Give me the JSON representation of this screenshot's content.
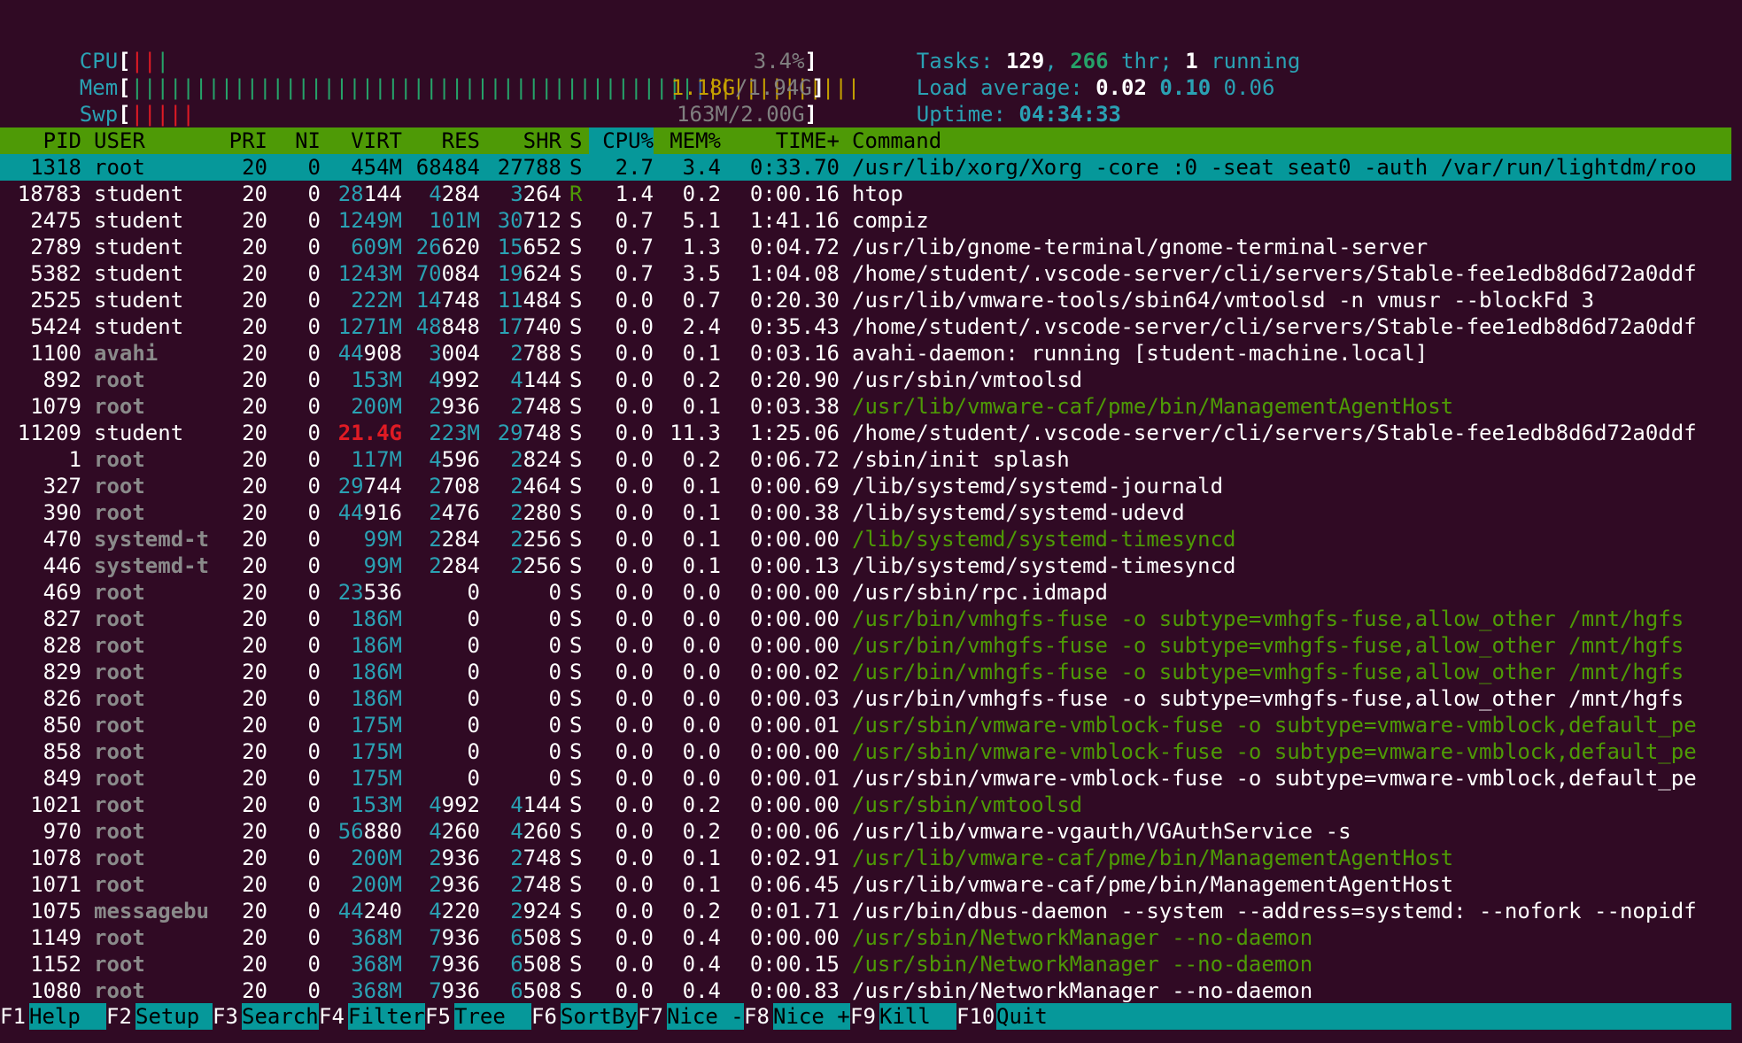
{
  "meters": {
    "cpu": {
      "label": "CPU",
      "value": "3.4%",
      "bars": [
        {
          "t": "||",
          "c": "#e01b24"
        },
        {
          "t": "|",
          "c": "#26a269"
        }
      ]
    },
    "mem": {
      "label": "Mem",
      "used": "1.18G",
      "total": "1.94G",
      "bars": [
        {
          "t": "||||||||||||||||||||||||||||||||||||||||||||",
          "c": "#26a269"
        },
        {
          "t": "|",
          "c": "#3465a4"
        },
        {
          "t": "||||||||||||",
          "c": "#c4a000"
        }
      ]
    },
    "swp": {
      "label": "Swp",
      "value": "163M/2.00G",
      "bars": [
        {
          "t": "|||||",
          "c": "#e01b24"
        }
      ]
    }
  },
  "info": {
    "tasks_label": "Tasks:",
    "tasks": "129",
    "thr": "266",
    "thr_label": "thr;",
    "running": "1",
    "running_label": "running",
    "load_label": "Load average:",
    "load1": "0.02",
    "load5": "0.10",
    "load15": "0.06",
    "uptime_label": "Uptime:",
    "uptime": "04:34:33"
  },
  "columns": [
    "PID",
    "USER",
    "PRI",
    "NI",
    "VIRT",
    "RES",
    "SHR",
    "S",
    "CPU%",
    "MEM%",
    "TIME+",
    "Command"
  ],
  "processes": [
    {
      "pid": "1318",
      "user": "root",
      "pri": "20",
      "ni": "0",
      "virt": "454M",
      "res": "68484",
      "shr": "27788",
      "s": "S",
      "cpu": "2.7",
      "mem": "3.4",
      "time": "0:33.70",
      "cmd": "/usr/lib/xorg/Xorg -core :0 -seat seat0 -auth /var/run/lightdm/roo",
      "selected": true
    },
    {
      "pid": "18783",
      "user": "student",
      "pri": "20",
      "ni": "0",
      "virt": "28144",
      "res": "4284",
      "shr": "3264",
      "s": "R",
      "cpu": "1.4",
      "mem": "0.2",
      "time": "0:00.16",
      "cmd": "htop"
    },
    {
      "pid": "2475",
      "user": "student",
      "pri": "20",
      "ni": "0",
      "virt": "1249M",
      "res": "101M",
      "shr": "30712",
      "s": "S",
      "cpu": "0.7",
      "mem": "5.1",
      "time": "1:41.16",
      "cmd": "compiz"
    },
    {
      "pid": "2789",
      "user": "student",
      "pri": "20",
      "ni": "0",
      "virt": "609M",
      "res": "26620",
      "shr": "15652",
      "s": "S",
      "cpu": "0.7",
      "mem": "1.3",
      "time": "0:04.72",
      "cmd": "/usr/lib/gnome-terminal/gnome-terminal-server"
    },
    {
      "pid": "5382",
      "user": "student",
      "pri": "20",
      "ni": "0",
      "virt": "1243M",
      "res": "70084",
      "shr": "19624",
      "s": "S",
      "cpu": "0.7",
      "mem": "3.5",
      "time": "1:04.08",
      "cmd": "/home/student/.vscode-server/cli/servers/Stable-fee1edb8d6d72a0ddf"
    },
    {
      "pid": "2525",
      "user": "student",
      "pri": "20",
      "ni": "0",
      "virt": "222M",
      "res": "14748",
      "shr": "11484",
      "s": "S",
      "cpu": "0.0",
      "mem": "0.7",
      "time": "0:20.30",
      "cmd": "/usr/lib/vmware-tools/sbin64/vmtoolsd -n vmusr --blockFd 3"
    },
    {
      "pid": "5424",
      "user": "student",
      "pri": "20",
      "ni": "0",
      "virt": "1271M",
      "res": "48848",
      "shr": "17740",
      "s": "S",
      "cpu": "0.0",
      "mem": "2.4",
      "time": "0:35.43",
      "cmd": "/home/student/.vscode-server/cli/servers/Stable-fee1edb8d6d72a0ddf"
    },
    {
      "pid": "1100",
      "user": "avahi",
      "pri": "20",
      "ni": "0",
      "virt": "44908",
      "res": "3004",
      "shr": "2788",
      "s": "S",
      "cpu": "0.0",
      "mem": "0.1",
      "time": "0:03.16",
      "cmd": "avahi-daemon: running [student-machine.local]"
    },
    {
      "pid": "892",
      "user": "root",
      "pri": "20",
      "ni": "0",
      "virt": "153M",
      "res": "4992",
      "shr": "4144",
      "s": "S",
      "cpu": "0.0",
      "mem": "0.2",
      "time": "0:20.90",
      "cmd": "/usr/sbin/vmtoolsd"
    },
    {
      "pid": "1079",
      "user": "root",
      "pri": "20",
      "ni": "0",
      "virt": "200M",
      "res": "2936",
      "shr": "2748",
      "s": "S",
      "cpu": "0.0",
      "mem": "0.1",
      "time": "0:03.38",
      "cmd": "/usr/lib/vmware-caf/pme/bin/ManagementAgentHost",
      "thread": true
    },
    {
      "pid": "11209",
      "user": "student",
      "pri": "20",
      "ni": "0",
      "virt": "21.4G",
      "res": "223M",
      "shr": "29748",
      "s": "S",
      "cpu": "0.0",
      "mem": "11.3",
      "time": "1:25.06",
      "cmd": "/home/student/.vscode-server/cli/servers/Stable-fee1edb8d6d72a0ddf",
      "virtRed": true
    },
    {
      "pid": "1",
      "user": "root",
      "pri": "20",
      "ni": "0",
      "virt": "117M",
      "res": "4596",
      "shr": "2824",
      "s": "S",
      "cpu": "0.0",
      "mem": "0.2",
      "time": "0:06.72",
      "cmd": "/sbin/init splash"
    },
    {
      "pid": "327",
      "user": "root",
      "pri": "20",
      "ni": "0",
      "virt": "29744",
      "res": "2708",
      "shr": "2464",
      "s": "S",
      "cpu": "0.0",
      "mem": "0.1",
      "time": "0:00.69",
      "cmd": "/lib/systemd/systemd-journald"
    },
    {
      "pid": "390",
      "user": "root",
      "pri": "20",
      "ni": "0",
      "virt": "44916",
      "res": "2476",
      "shr": "2280",
      "s": "S",
      "cpu": "0.0",
      "mem": "0.1",
      "time": "0:00.38",
      "cmd": "/lib/systemd/systemd-udevd"
    },
    {
      "pid": "470",
      "user": "systemd-t",
      "pri": "20",
      "ni": "0",
      "virt": "99M",
      "res": "2284",
      "shr": "2256",
      "s": "S",
      "cpu": "0.0",
      "mem": "0.1",
      "time": "0:00.00",
      "cmd": "/lib/systemd/systemd-timesyncd",
      "thread": true
    },
    {
      "pid": "446",
      "user": "systemd-t",
      "pri": "20",
      "ni": "0",
      "virt": "99M",
      "res": "2284",
      "shr": "2256",
      "s": "S",
      "cpu": "0.0",
      "mem": "0.1",
      "time": "0:00.13",
      "cmd": "/lib/systemd/systemd-timesyncd"
    },
    {
      "pid": "469",
      "user": "root",
      "pri": "20",
      "ni": "0",
      "virt": "23536",
      "res": "0",
      "shr": "0",
      "s": "S",
      "cpu": "0.0",
      "mem": "0.0",
      "time": "0:00.00",
      "cmd": "/usr/sbin/rpc.idmapd"
    },
    {
      "pid": "827",
      "user": "root",
      "pri": "20",
      "ni": "0",
      "virt": "186M",
      "res": "0",
      "shr": "0",
      "s": "S",
      "cpu": "0.0",
      "mem": "0.0",
      "time": "0:00.00",
      "cmd": "/usr/bin/vmhgfs-fuse -o subtype=vmhgfs-fuse,allow_other /mnt/hgfs",
      "thread": true
    },
    {
      "pid": "828",
      "user": "root",
      "pri": "20",
      "ni": "0",
      "virt": "186M",
      "res": "0",
      "shr": "0",
      "s": "S",
      "cpu": "0.0",
      "mem": "0.0",
      "time": "0:00.00",
      "cmd": "/usr/bin/vmhgfs-fuse -o subtype=vmhgfs-fuse,allow_other /mnt/hgfs",
      "thread": true
    },
    {
      "pid": "829",
      "user": "root",
      "pri": "20",
      "ni": "0",
      "virt": "186M",
      "res": "0",
      "shr": "0",
      "s": "S",
      "cpu": "0.0",
      "mem": "0.0",
      "time": "0:00.02",
      "cmd": "/usr/bin/vmhgfs-fuse -o subtype=vmhgfs-fuse,allow_other /mnt/hgfs",
      "thread": true
    },
    {
      "pid": "826",
      "user": "root",
      "pri": "20",
      "ni": "0",
      "virt": "186M",
      "res": "0",
      "shr": "0",
      "s": "S",
      "cpu": "0.0",
      "mem": "0.0",
      "time": "0:00.03",
      "cmd": "/usr/bin/vmhgfs-fuse -o subtype=vmhgfs-fuse,allow_other /mnt/hgfs"
    },
    {
      "pid": "850",
      "user": "root",
      "pri": "20",
      "ni": "0",
      "virt": "175M",
      "res": "0",
      "shr": "0",
      "s": "S",
      "cpu": "0.0",
      "mem": "0.0",
      "time": "0:00.01",
      "cmd": "/usr/sbin/vmware-vmblock-fuse -o subtype=vmware-vmblock,default_pe",
      "thread": true
    },
    {
      "pid": "858",
      "user": "root",
      "pri": "20",
      "ni": "0",
      "virt": "175M",
      "res": "0",
      "shr": "0",
      "s": "S",
      "cpu": "0.0",
      "mem": "0.0",
      "time": "0:00.00",
      "cmd": "/usr/sbin/vmware-vmblock-fuse -o subtype=vmware-vmblock,default_pe",
      "thread": true
    },
    {
      "pid": "849",
      "user": "root",
      "pri": "20",
      "ni": "0",
      "virt": "175M",
      "res": "0",
      "shr": "0",
      "s": "S",
      "cpu": "0.0",
      "mem": "0.0",
      "time": "0:00.01",
      "cmd": "/usr/sbin/vmware-vmblock-fuse -o subtype=vmware-vmblock,default_pe"
    },
    {
      "pid": "1021",
      "user": "root",
      "pri": "20",
      "ni": "0",
      "virt": "153M",
      "res": "4992",
      "shr": "4144",
      "s": "S",
      "cpu": "0.0",
      "mem": "0.2",
      "time": "0:00.00",
      "cmd": "/usr/sbin/vmtoolsd",
      "thread": true
    },
    {
      "pid": "970",
      "user": "root",
      "pri": "20",
      "ni": "0",
      "virt": "56880",
      "res": "4260",
      "shr": "4260",
      "s": "S",
      "cpu": "0.0",
      "mem": "0.2",
      "time": "0:00.06",
      "cmd": "/usr/lib/vmware-vgauth/VGAuthService -s"
    },
    {
      "pid": "1078",
      "user": "root",
      "pri": "20",
      "ni": "0",
      "virt": "200M",
      "res": "2936",
      "shr": "2748",
      "s": "S",
      "cpu": "0.0",
      "mem": "0.1",
      "time": "0:02.91",
      "cmd": "/usr/lib/vmware-caf/pme/bin/ManagementAgentHost",
      "thread": true
    },
    {
      "pid": "1071",
      "user": "root",
      "pri": "20",
      "ni": "0",
      "virt": "200M",
      "res": "2936",
      "shr": "2748",
      "s": "S",
      "cpu": "0.0",
      "mem": "0.1",
      "time": "0:06.45",
      "cmd": "/usr/lib/vmware-caf/pme/bin/ManagementAgentHost"
    },
    {
      "pid": "1075",
      "user": "messagebu",
      "pri": "20",
      "ni": "0",
      "virt": "44240",
      "res": "4220",
      "shr": "2924",
      "s": "S",
      "cpu": "0.0",
      "mem": "0.2",
      "time": "0:01.71",
      "cmd": "/usr/bin/dbus-daemon --system --address=systemd: --nofork --nopidf"
    },
    {
      "pid": "1149",
      "user": "root",
      "pri": "20",
      "ni": "0",
      "virt": "368M",
      "res": "7936",
      "shr": "6508",
      "s": "S",
      "cpu": "0.0",
      "mem": "0.4",
      "time": "0:00.00",
      "cmd": "/usr/sbin/NetworkManager --no-daemon",
      "thread": true
    },
    {
      "pid": "1152",
      "user": "root",
      "pri": "20",
      "ni": "0",
      "virt": "368M",
      "res": "7936",
      "shr": "6508",
      "s": "S",
      "cpu": "0.0",
      "mem": "0.4",
      "time": "0:00.15",
      "cmd": "/usr/sbin/NetworkManager --no-daemon",
      "thread": true
    },
    {
      "pid": "1080",
      "user": "root",
      "pri": "20",
      "ni": "0",
      "virt": "368M",
      "res": "7936",
      "shr": "6508",
      "s": "S",
      "cpu": "0.0",
      "mem": "0.4",
      "time": "0:00.83",
      "cmd": "/usr/sbin/NetworkManager --no-daemon"
    }
  ],
  "footer": [
    {
      "key": "F1",
      "label": "Help"
    },
    {
      "key": "F2",
      "label": "Setup"
    },
    {
      "key": "F3",
      "label": "Search"
    },
    {
      "key": "F4",
      "label": "Filter"
    },
    {
      "key": "F5",
      "label": "Tree"
    },
    {
      "key": "F6",
      "label": "SortBy"
    },
    {
      "key": "F7",
      "label": "Nice -"
    },
    {
      "key": "F8",
      "label": "Nice +"
    },
    {
      "key": "F9",
      "label": "Kill"
    },
    {
      "key": "F10",
      "label": "Quit"
    }
  ],
  "colors": {
    "background": "#300a24",
    "header_bar": "#4e9a06",
    "selected_row": "#06989a",
    "accent": "#2aa1b3"
  }
}
